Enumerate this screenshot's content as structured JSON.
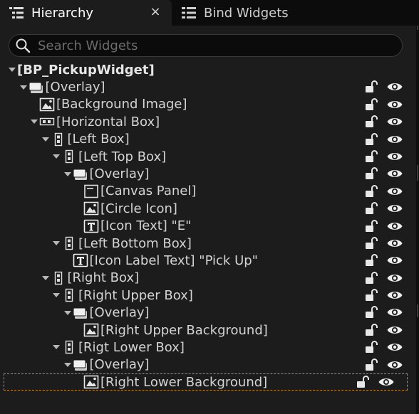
{
  "tabs": [
    {
      "label": "Hierarchy",
      "icon": "hierarchy-icon",
      "active": true,
      "close": "×"
    },
    {
      "label": "Bind Widgets",
      "icon": "bind-widgets-icon",
      "active": false
    }
  ],
  "search": {
    "placeholder": "Search Widgets",
    "value": ""
  },
  "colors": {
    "background": "#1c1c1c",
    "tabbar": "#0c0c0c",
    "text": "#d4d4d4",
    "selection_outline": "#c88a2a",
    "icon": "#e0e0e0"
  },
  "tree": [
    {
      "label": "[BP_PickupWidget]",
      "depth": 0,
      "expanded": true,
      "icon": "",
      "root": true
    },
    {
      "label": "[Overlay]",
      "depth": 1,
      "expanded": true,
      "icon": "overlay-icon"
    },
    {
      "label": "[Background Image]",
      "depth": 2,
      "expanded": null,
      "icon": "image-icon"
    },
    {
      "label": "[Horizontal Box]",
      "depth": 2,
      "expanded": true,
      "icon": "horizontal-box-icon"
    },
    {
      "label": "[Left Box]",
      "depth": 3,
      "expanded": true,
      "icon": "vertical-box-icon"
    },
    {
      "label": "[Left Top Box]",
      "depth": 4,
      "expanded": true,
      "icon": "vertical-box-icon"
    },
    {
      "label": "[Overlay]",
      "depth": 5,
      "expanded": true,
      "icon": "overlay-icon"
    },
    {
      "label": "[Canvas Panel]",
      "depth": 6,
      "expanded": null,
      "icon": "canvas-panel-icon"
    },
    {
      "label": "[Circle Icon]",
      "depth": 6,
      "expanded": null,
      "icon": "image-icon"
    },
    {
      "label": "[Icon Text] \"E\"",
      "depth": 6,
      "expanded": null,
      "icon": "text-icon"
    },
    {
      "label": "[Left Bottom Box]",
      "depth": 4,
      "expanded": true,
      "icon": "vertical-box-icon"
    },
    {
      "label": "[Icon Label Text] \"Pick Up\"",
      "depth": 5,
      "expanded": null,
      "icon": "text-icon"
    },
    {
      "label": "[Right Box]",
      "depth": 3,
      "expanded": true,
      "icon": "vertical-box-icon"
    },
    {
      "label": "[Right Upper Box]",
      "depth": 4,
      "expanded": true,
      "icon": "vertical-box-icon"
    },
    {
      "label": "[Overlay]",
      "depth": 5,
      "expanded": true,
      "icon": "overlay-icon"
    },
    {
      "label": "[Right Upper Background]",
      "depth": 6,
      "expanded": null,
      "icon": "image-icon"
    },
    {
      "label": "[Rigt Lower Box]",
      "depth": 4,
      "expanded": true,
      "icon": "vertical-box-icon"
    },
    {
      "label": "[Overlay]",
      "depth": 5,
      "expanded": true,
      "icon": "overlay-icon"
    },
    {
      "label": "[Right Lower Background]",
      "depth": 6,
      "expanded": null,
      "icon": "image-icon",
      "selected": true
    }
  ]
}
